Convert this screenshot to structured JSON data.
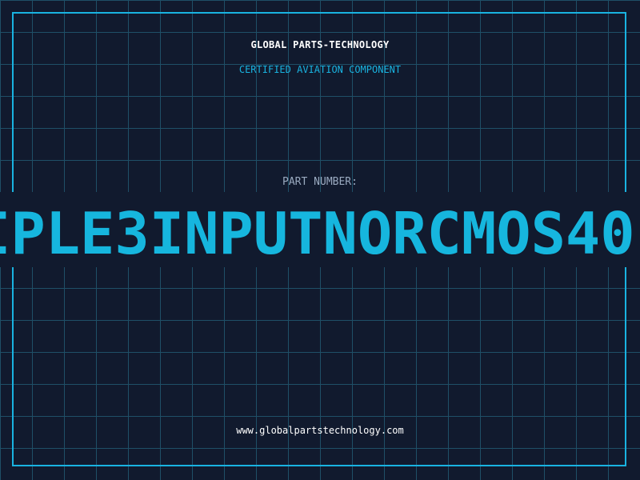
{
  "header": {
    "company": "GLOBAL PARTS-TECHNOLOGY",
    "subtitle": "CERTIFIED AVIATION COMPONENT"
  },
  "part": {
    "label": "PART NUMBER:",
    "number": "IPLE3INPUTNORCMOS40"
  },
  "footer": {
    "url": "www.globalpartstechnology.com"
  },
  "colors": {
    "background": "#111a2e",
    "grid": "#1f4f67",
    "accent": "#19b3e0",
    "text": "#ffffff",
    "label": "#9aaac0"
  }
}
